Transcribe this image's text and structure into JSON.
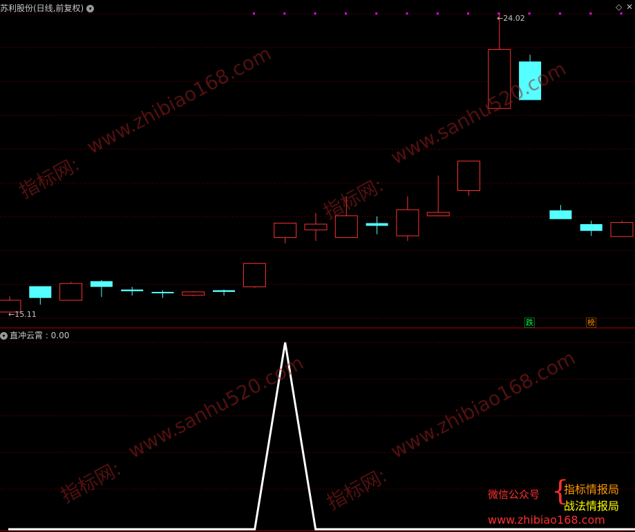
{
  "main_panel": {
    "title": "苏利股份(日线,前复权)",
    "high_label": "24.02",
    "low_label": "15.11",
    "badges": [
      {
        "text": "跌",
        "color": "#00ff44"
      },
      {
        "text": "榜",
        "color": "#ff8c00"
      }
    ]
  },
  "indicator_panel": {
    "title": "直冲云霄 : 0.00"
  },
  "watermarks": [
    "www.zhibiao168.com",
    "www.sanhu520.com",
    "指标网:"
  ],
  "promo": {
    "wechat": "微信公众号",
    "name1": "指标情报局",
    "name2": "战法情报局",
    "site": "www.zhibiao168.com"
  },
  "colors": {
    "up": "#ff3232",
    "down": "#54ffff",
    "grid": "#8b0000",
    "signal": "#ffffff",
    "marker": "#ff00ff"
  },
  "chart_data": {
    "type": "candlestick",
    "price_range": [
      15.11,
      24.02
    ],
    "candles": [
      {
        "o": 15.13,
        "c": 15.48,
        "h": 15.6,
        "l": 15.11
      },
      {
        "o": 15.9,
        "c": 15.55,
        "h": 15.9,
        "l": 15.35
      },
      {
        "o": 15.48,
        "c": 15.98,
        "h": 16.03,
        "l": 15.48
      },
      {
        "o": 16.05,
        "c": 15.88,
        "h": 16.08,
        "l": 15.58
      },
      {
        "o": 15.8,
        "c": 15.75,
        "h": 15.88,
        "l": 15.62
      },
      {
        "o": 15.73,
        "c": 15.7,
        "h": 15.78,
        "l": 15.55
      },
      {
        "o": 15.63,
        "c": 15.73,
        "h": 15.75,
        "l": 15.6
      },
      {
        "o": 15.78,
        "c": 15.73,
        "h": 15.8,
        "l": 15.62
      },
      {
        "o": 15.88,
        "c": 16.58,
        "h": 16.58,
        "l": 15.85
      },
      {
        "o": 17.35,
        "c": 17.78,
        "h": 17.78,
        "l": 17.18
      },
      {
        "o": 17.58,
        "c": 17.75,
        "h": 18.08,
        "l": 17.25
      },
      {
        "o": 17.35,
        "c": 18.0,
        "h": 18.58,
        "l": 17.35
      },
      {
        "o": 17.78,
        "c": 17.7,
        "h": 17.98,
        "l": 17.45
      },
      {
        "o": 17.4,
        "c": 18.18,
        "h": 18.58,
        "l": 17.25
      },
      {
        "o": 18.0,
        "c": 18.1,
        "h": 19.2,
        "l": 18.0
      },
      {
        "o": 18.75,
        "c": 19.63,
        "h": 19.63,
        "l": 18.6
      },
      {
        "o": 21.2,
        "c": 22.96,
        "h": 24.02,
        "l": 21.2
      },
      {
        "o": 22.6,
        "c": 21.45,
        "h": 22.8,
        "l": 21.45
      },
      {
        "o": 18.16,
        "c": 17.9,
        "h": 18.32,
        "l": 17.9
      },
      {
        "o": 17.75,
        "c": 17.55,
        "h": 17.85,
        "l": 17.4
      },
      {
        "o": 17.38,
        "c": 17.8,
        "h": 17.85,
        "l": 17.38
      }
    ],
    "signal_series": {
      "name": "直冲云霄",
      "values": [
        0,
        0,
        0,
        0,
        0,
        0,
        0,
        0,
        0,
        1,
        0,
        0,
        0,
        0,
        0,
        0,
        0,
        0,
        0,
        0,
        0
      ],
      "range": [
        0,
        1
      ]
    }
  }
}
